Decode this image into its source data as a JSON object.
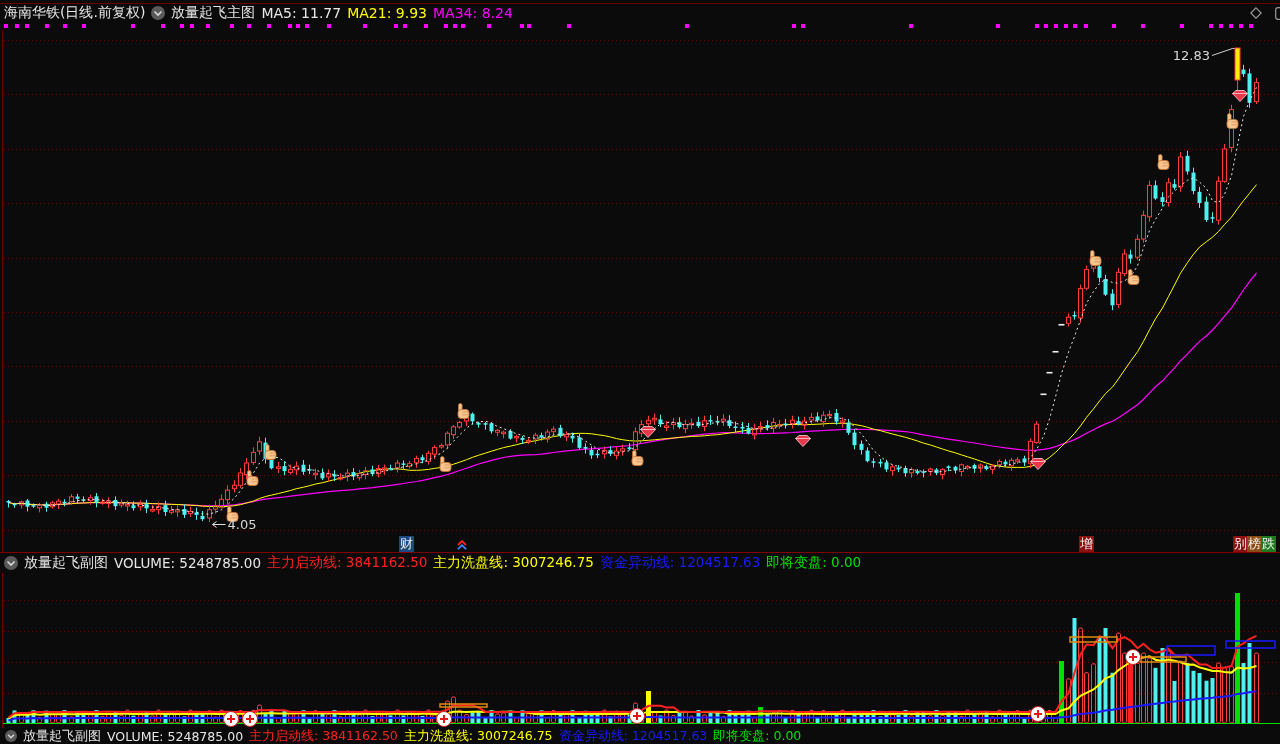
{
  "main_chart": {
    "title": "海南华铁(日线.前复权)",
    "indicator": "放量起飞主图",
    "legend": [
      {
        "label": "MA5: 11.77",
        "color": "#e8e8e8"
      },
      {
        "label": "MA21: 9.93",
        "color": "#ffff00"
      },
      {
        "label": "MA34: 8.24",
        "color": "#ff00ff"
      }
    ],
    "high_label": "12.83",
    "low_label": "4.05"
  },
  "event_markers": [
    {
      "text": "财",
      "color": "#1c4a80"
    },
    {
      "text": "增",
      "color": "#8c1010"
    },
    {
      "text": "别",
      "color": "#8c1010"
    },
    {
      "text": "榜",
      "color": "#8a4a12"
    },
    {
      "text": "跌",
      "color": "#1e7a1e"
    }
  ],
  "sub_chart": {
    "indicator": "放量起飞副图",
    "volume": "VOLUME: 5248785.00",
    "legend": [
      {
        "label": "主力启动线: 3841162.50",
        "color": "#ff2020"
      },
      {
        "label": "主力洗盘线: 3007246.75",
        "color": "#ffff00"
      },
      {
        "label": "资金异动线: 1204517.63",
        "color": "#1a1aff"
      },
      {
        "label": "即将变盘: 0.00",
        "color": "#00e000"
      }
    ]
  },
  "sub_chart_repeat": {
    "indicator": "放量起飞副图",
    "volume": "VOLUME: 5248785.00",
    "legend": [
      {
        "label": "主力启动线: 3841162.50",
        "color": "#ff2020"
      },
      {
        "label": "主力洗盘线: 3007246.75",
        "color": "#ffff00"
      },
      {
        "label": "资金异动线: 1204517.63",
        "color": "#1a1aff"
      },
      {
        "label": "即将变盘: 0.00",
        "color": "#00e000"
      }
    ]
  }
}
